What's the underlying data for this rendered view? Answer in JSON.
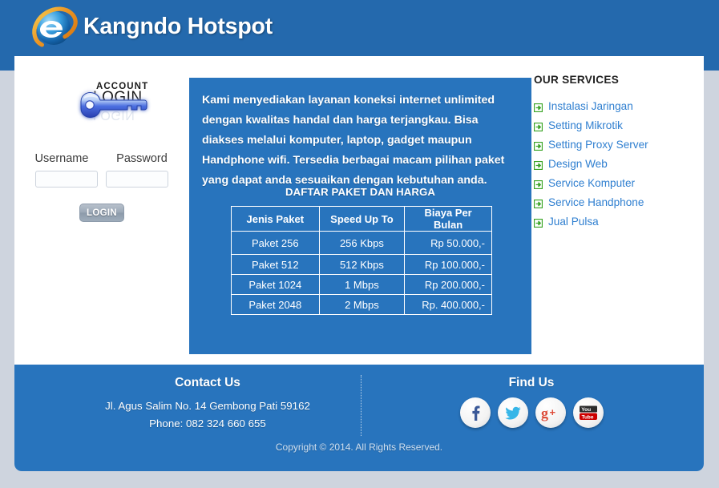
{
  "header": {
    "title": "Kangndo Hotspot",
    "logo_icon": "internet-explorer-logo",
    "bg_color": "#2469ad"
  },
  "login": {
    "art_title_small": "ACCOUNT",
    "art_title_large": "LOGIN",
    "key_icon": "key-icon",
    "username_label": "Username",
    "password_label": "Password",
    "username_value": "",
    "password_value": "",
    "username_placeholder": "",
    "password_placeholder": "",
    "button_label": "LOGIN"
  },
  "main": {
    "intro_text": "Kami menyediakan layanan koneksi internet unlimited dengan kwalitas handal dan harga terjangkau. Bisa diakses melalui komputer, laptop, gadget maupun Handphone wifi. Tersedia berbagai macam pilihan paket yang dapat anda sesuaikan dengan kebutuhan anda.",
    "table_heading": "DAFTAR PAKET DAN HARGA",
    "panel_color": "#2874bd",
    "table": {
      "columns": [
        "Jenis Paket",
        "Speed Up To",
        "Biaya Per Bulan"
      ],
      "rows": [
        [
          "Paket 256",
          "256 Kbps",
          "Rp 50.000,-"
        ],
        [
          "Paket 512",
          "512 Kbps",
          "Rp 100.000,-"
        ],
        [
          "Paket 1024",
          "1 Mbps",
          "Rp 200.000,-"
        ],
        [
          "Paket 2048",
          "2 Mbps",
          "Rp. 400.000,-"
        ]
      ]
    }
  },
  "services": {
    "title": "OUR SERVICES",
    "link_color": "#2f7fd0",
    "bullet_color": "#3aa425",
    "items": [
      {
        "label": "Instalasi Jaringan",
        "icon": "arrow-right-box-icon"
      },
      {
        "label": "Setting Mikrotik",
        "icon": "arrow-right-box-icon"
      },
      {
        "label": "Setting Proxy Server",
        "icon": "arrow-right-box-icon"
      },
      {
        "label": "Design Web",
        "icon": "arrow-right-box-icon"
      },
      {
        "label": "Service Komputer",
        "icon": "arrow-right-box-icon"
      },
      {
        "label": "Service Handphone",
        "icon": "arrow-right-box-icon"
      },
      {
        "label": "Jual Pulsa",
        "icon": "arrow-right-box-icon"
      }
    ]
  },
  "footer": {
    "contact_title": "Contact Us",
    "address": "Jl. Agus Salim No. 14 Gembong Pati 59162",
    "phone": "Phone: 082 324 660 655",
    "findus_title": "Find Us",
    "social": [
      {
        "name": "facebook-icon",
        "label": "f"
      },
      {
        "name": "twitter-icon",
        "label": ""
      },
      {
        "name": "google-plus-icon",
        "label": "g+"
      },
      {
        "name": "youtube-icon",
        "label": "You Tube"
      }
    ],
    "copyright": "Copyright © 2014. All Rights Reserved."
  }
}
